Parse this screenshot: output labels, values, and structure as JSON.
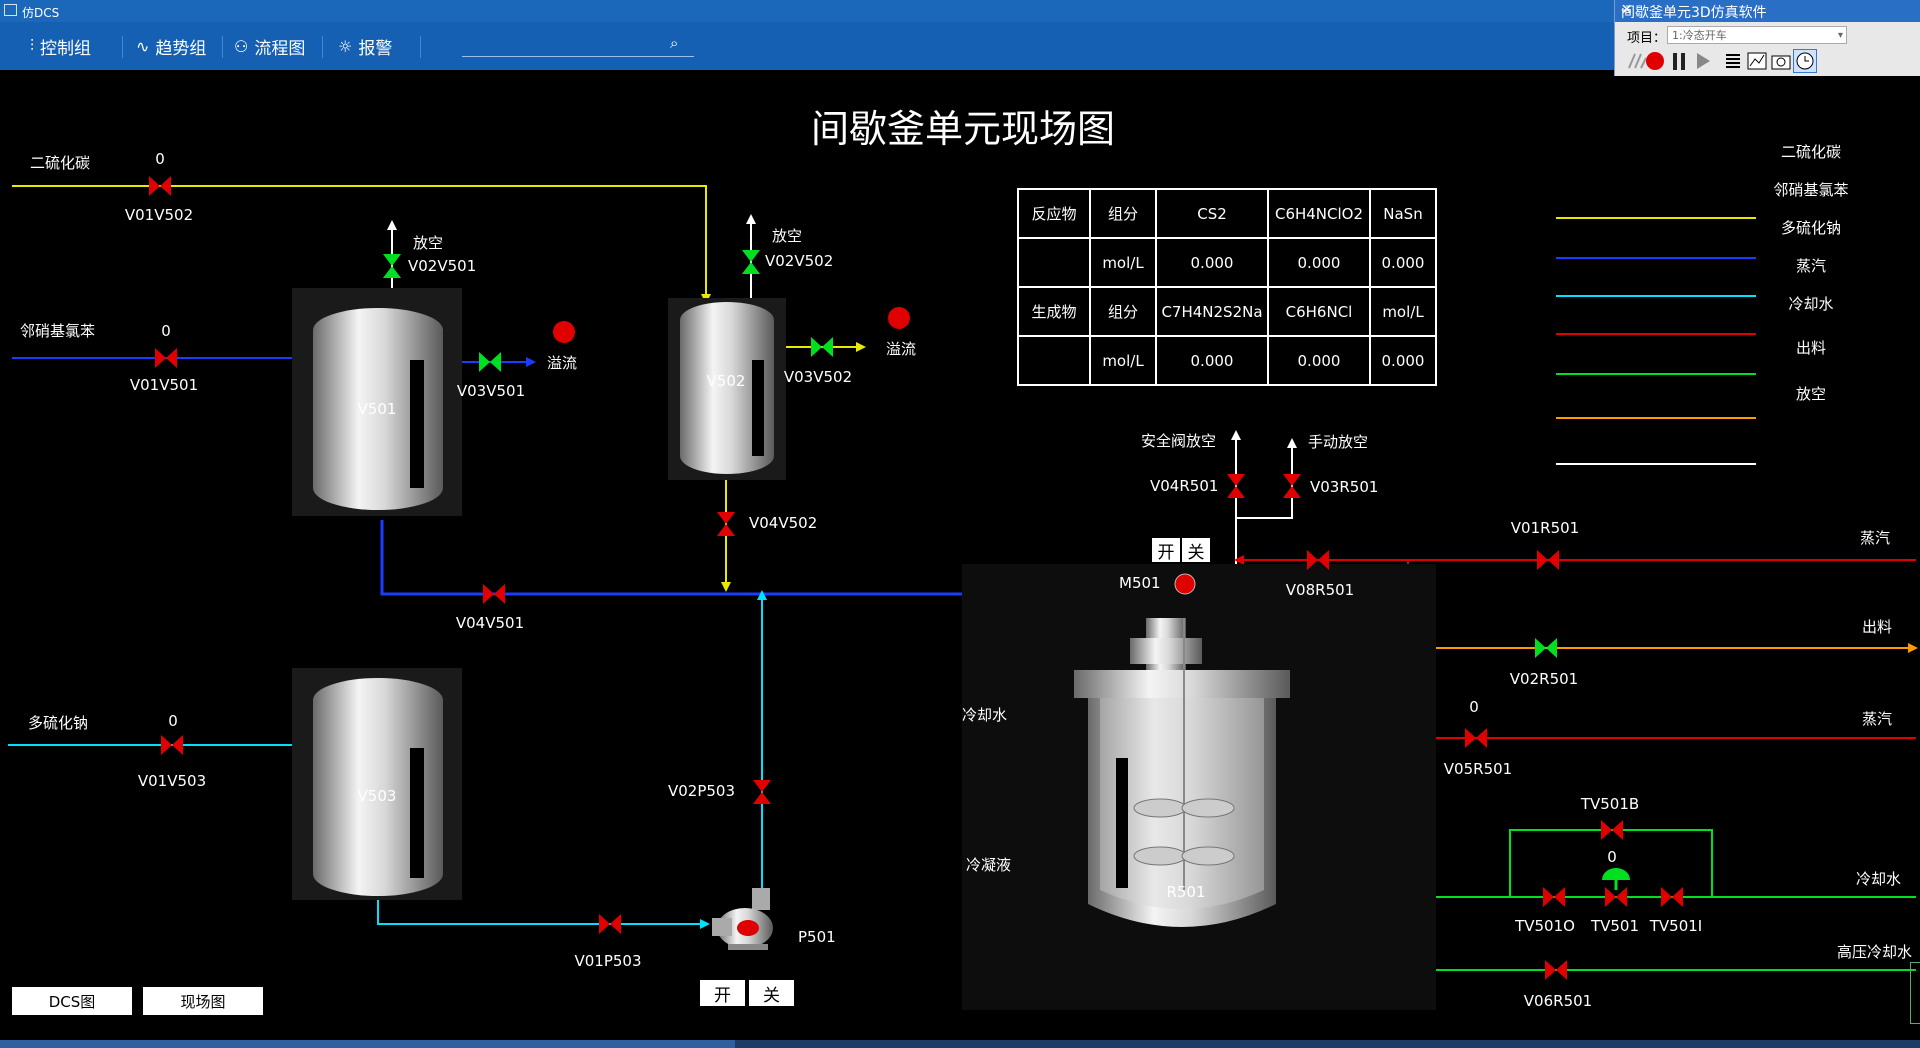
{
  "window": {
    "title": "仿DCS"
  },
  "toolbar": {
    "items": [
      "控制组",
      "趋势组",
      "流程图",
      "报警"
    ],
    "search_value": ""
  },
  "sim": {
    "title": "间歇釜单元3D仿真软件",
    "project_label": "项目：",
    "project_value": "1:冷态开车"
  },
  "title": "间歇釜单元现场图",
  "labels": {
    "cs2_feed": "二硫化碳",
    "onca_feed": "邻硝基氯苯",
    "na2sn_feed": "多硫化钠",
    "vent": "放空",
    "overflow": "溢流",
    "safety_vent": "安全阀放空",
    "manual_vent": "手动放空",
    "steam": "蒸汽",
    "discharge": "出料",
    "cooling_water": "冷却水",
    "condensate": "冷凝液",
    "hp_cooling_water": "高压冷却水",
    "open": "开",
    "close": "关"
  },
  "vessels": {
    "v501": "V501",
    "v502": "V502",
    "v503": "V503",
    "r501": "R501",
    "p501": "P501",
    "m501": "M501"
  },
  "valves": {
    "V01V502": {
      "tag": "V01V502",
      "value": "0"
    },
    "V01V501": {
      "tag": "V01V501",
      "value": "0"
    },
    "V01V503": {
      "tag": "V01V503",
      "value": "0"
    },
    "V02V501": {
      "tag": "V02V501"
    },
    "V02V502": {
      "tag": "V02V502"
    },
    "V03V501": {
      "tag": "V03V501"
    },
    "V03V502": {
      "tag": "V03V502"
    },
    "V04V501": {
      "tag": "V04V501"
    },
    "V04V502": {
      "tag": "V04V502"
    },
    "V02P503": {
      "tag": "V02P503"
    },
    "V01P503": {
      "tag": "V01P503"
    },
    "V04R501": {
      "tag": "V04R501"
    },
    "V03R501": {
      "tag": "V03R501"
    },
    "V08R501": {
      "tag": "V08R501"
    },
    "V01R501": {
      "tag": "V01R501"
    },
    "V02R501": {
      "tag": "V02R501"
    },
    "V05R501": {
      "tag": "V05R501",
      "value": "0"
    },
    "TV501B": {
      "tag": "TV501B"
    },
    "TV501": {
      "tag": "TV501",
      "value": "0"
    },
    "TV501O": {
      "tag": "TV501O"
    },
    "TV501I": {
      "tag": "TV501I"
    },
    "V06R501": {
      "tag": "V06R501"
    }
  },
  "table": {
    "rows": [
      [
        "反应物",
        "组分",
        "CS2",
        "C6H4NClO2",
        "NaSn"
      ],
      [
        "",
        "mol/L",
        "0.000",
        "0.000",
        "0.000"
      ],
      [
        "生成物",
        "组分",
        "C7H4N2S2Na",
        "C6H6NCl",
        "mol/L"
      ],
      [
        "",
        "mol/L",
        "0.000",
        "0.000",
        "0.000"
      ]
    ]
  },
  "legend": [
    {
      "label": "二硫化碳",
      "color": "#e8e800"
    },
    {
      "label": "邻硝基氯苯",
      "color": "#1a3cff"
    },
    {
      "label": "多硫化钠",
      "color": "#00e0ff"
    },
    {
      "label": "蒸汽",
      "color": "#e00000"
    },
    {
      "label": "冷却水",
      "color": "#00e020"
    },
    {
      "label": "出料",
      "color": "#ff9a00"
    },
    {
      "label": "放空",
      "color": "#ffffff"
    }
  ],
  "nav": {
    "dcs": "DCS图",
    "field": "现场图"
  }
}
